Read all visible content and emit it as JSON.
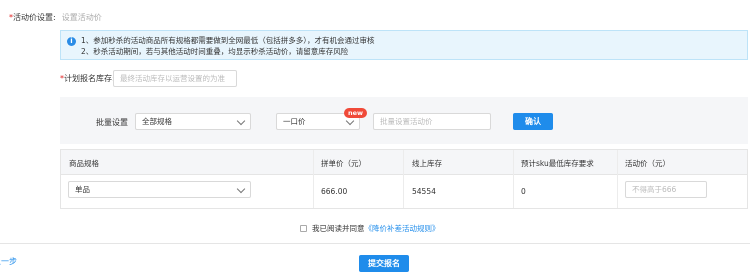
{
  "activity_price": {
    "required_mark": "*",
    "label": "活动价设置:",
    "value": "设置活动价"
  },
  "notice": {
    "icon": "info-icon",
    "lines": [
      "1、参加秒杀的活动商品所有规格都需要做到全网最低（包括拼多多），才有机会通过审核",
      "2、秒杀活动期间，若与其他活动时间重叠，均显示秒杀活动价，请留意库存风险"
    ]
  },
  "stock": {
    "required_mark": "*",
    "label": "计划报名库存:",
    "placeholder": "最终活动库存以运营设置的为准"
  },
  "batch": {
    "label": "批量设置",
    "spec_select": "全部规格",
    "price_type_select": "一口价",
    "new_badge": "new",
    "price_placeholder": "批量设置活动价",
    "confirm_button": "确认"
  },
  "table": {
    "headers": [
      "商品规格",
      "拼单价（元）",
      "线上库存",
      "预计sku最低库存要求",
      "活动价（元）"
    ],
    "rows": [
      {
        "spec": "单品",
        "group_price": "666.00",
        "online_stock": "54554",
        "min_stock": "0",
        "activity_price_placeholder": "不得高于666"
      }
    ]
  },
  "agreement": {
    "text": "我已阅读并同意",
    "link": "《降价补差活动规则》"
  },
  "footer": {
    "prev_link": "上一步",
    "submit_button": "提交报名"
  },
  "colors": {
    "primary": "#1f8ceb",
    "required": "#e02020",
    "badge": "#f04a39",
    "notice_bg": "#e8f5fd"
  }
}
